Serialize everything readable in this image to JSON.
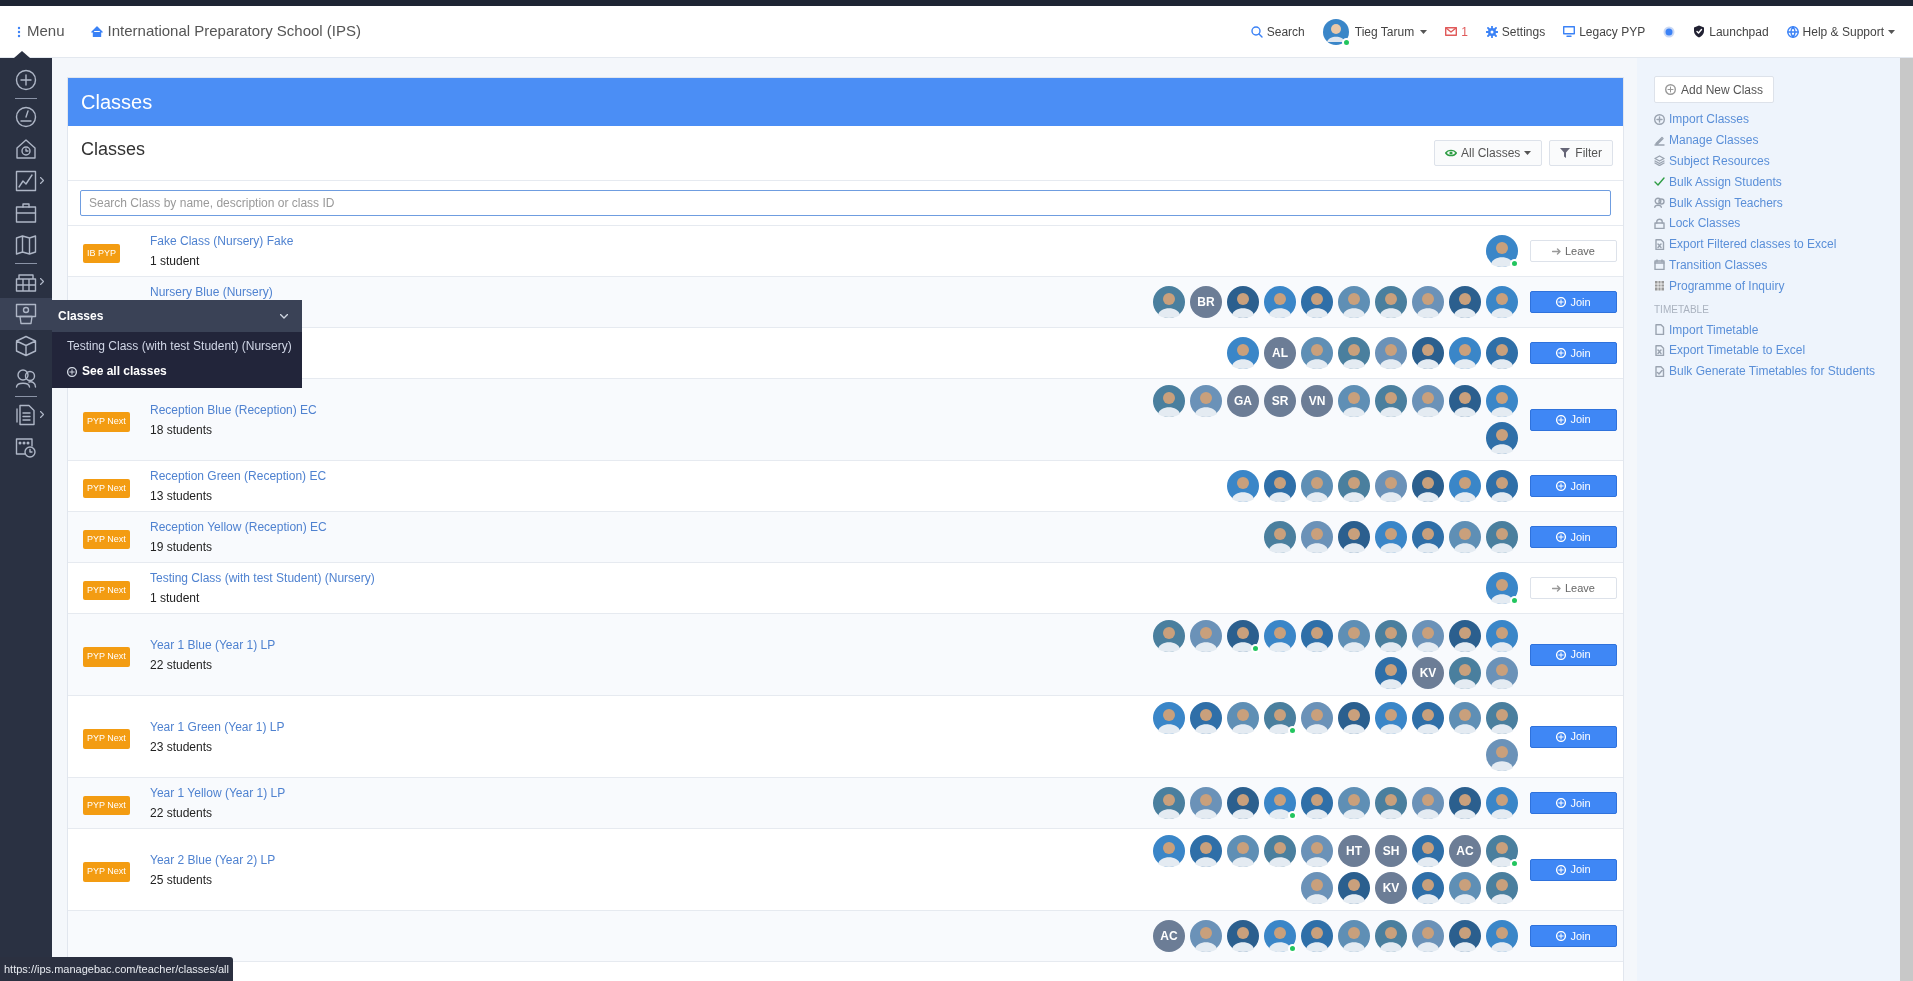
{
  "top_bar": {
    "menu_label": "Menu",
    "school": "International Preparatory School (IPS)",
    "search": "Search",
    "user": {
      "name": "Tieg Tarum",
      "online": true
    },
    "messages": "1",
    "settings": "Settings",
    "legacy": "Legacy PYP",
    "launchpad": "Launchpad",
    "help": "Help & Support"
  },
  "sidebar": {
    "items": [
      {
        "selected": false,
        "submenu": false
      },
      {
        "selected": false,
        "submenu": false
      },
      {
        "selected": false,
        "submenu": false
      },
      {
        "selected": false,
        "submenu": true
      },
      {
        "selected": false,
        "submenu": false
      },
      {
        "selected": false,
        "submenu": false
      },
      {
        "selected": false,
        "submenu": true
      },
      {
        "selected": true,
        "submenu": false
      },
      {
        "selected": false,
        "submenu": false
      },
      {
        "selected": false,
        "submenu": false
      },
      {
        "selected": false,
        "submenu": true
      },
      {
        "selected": false,
        "submenu": false
      }
    ]
  },
  "classes_flyout": {
    "title": "Classes",
    "items": [
      "Testing Class (with test Student) (Nursery)"
    ],
    "see_all": "See all classes"
  },
  "page": {
    "banner": "Classes",
    "subtitle": "Classes",
    "view_button": "All Classes",
    "filter_button": "Filter",
    "search": {
      "placeholder": "Search Class by name, description or class ID"
    }
  },
  "classes": [
    {
      "badge": "IB PYP",
      "name": "Fake Class (Nursery) Fake",
      "count": "1 student",
      "members": [
        {
          "kind": "photo",
          "online": true
        }
      ],
      "action": {
        "kind": "leave",
        "label": "Leave"
      }
    },
    {
      "name": "Nursery Blue (Nursery)",
      "members": [
        {
          "kind": "photo",
          "online": false
        },
        {
          "kind": "initials",
          "text": "BR",
          "online": false
        },
        {
          "kind": "photo",
          "online": false
        },
        {
          "kind": "photo",
          "online": false
        },
        {
          "kind": "photo",
          "online": false
        },
        {
          "kind": "photo",
          "online": false
        },
        {
          "kind": "photo",
          "online": false
        },
        {
          "kind": "photo",
          "online": false
        },
        {
          "kind": "photo",
          "online": false
        },
        {
          "kind": "photo",
          "online": false
        }
      ],
      "action": {
        "kind": "join",
        "label": "Join"
      }
    },
    {
      "members": [
        {
          "kind": "photo",
          "online": false
        },
        {
          "kind": "initials",
          "text": "AL",
          "online": false
        },
        {
          "kind": "photo",
          "online": false
        },
        {
          "kind": "photo",
          "online": false
        },
        {
          "kind": "photo",
          "online": false
        },
        {
          "kind": "photo",
          "online": false
        },
        {
          "kind": "photo",
          "online": false
        },
        {
          "kind": "photo",
          "online": false
        }
      ],
      "action": {
        "kind": "join",
        "label": "Join"
      }
    },
    {
      "badge": "PYP Next",
      "name": "Reception Blue (Reception) EC",
      "count": "18 students",
      "members": [
        {
          "kind": "photo",
          "online": false
        },
        {
          "kind": "photo",
          "online": false
        },
        {
          "kind": "initials",
          "text": "GA",
          "online": false
        },
        {
          "kind": "initials",
          "text": "SR",
          "online": false
        },
        {
          "kind": "initials",
          "text": "VN",
          "online": false
        },
        {
          "kind": "photo",
          "online": false
        },
        {
          "kind": "photo",
          "online": false
        },
        {
          "kind": "photo",
          "online": false
        },
        {
          "kind": "photo",
          "online": false
        },
        {
          "kind": "photo",
          "online": false
        },
        {
          "kind": "photo",
          "online": false
        }
      ],
      "action": {
        "kind": "join",
        "label": "Join"
      }
    },
    {
      "badge": "PYP Next",
      "name": "Reception Green (Reception) EC",
      "count": "13 students",
      "members": [
        {
          "kind": "photo",
          "online": false
        },
        {
          "kind": "photo",
          "online": false
        },
        {
          "kind": "photo",
          "online": false
        },
        {
          "kind": "photo",
          "online": false
        },
        {
          "kind": "photo",
          "online": false
        },
        {
          "kind": "photo",
          "online": false
        },
        {
          "kind": "photo",
          "online": false
        },
        {
          "kind": "photo",
          "online": false
        }
      ],
      "action": {
        "kind": "join",
        "label": "Join"
      }
    },
    {
      "badge": "PYP Next",
      "name": "Reception Yellow (Reception) EC",
      "count": "19 students",
      "members": [
        {
          "kind": "photo",
          "online": false
        },
        {
          "kind": "photo",
          "online": false
        },
        {
          "kind": "photo",
          "online": false
        },
        {
          "kind": "photo",
          "online": false
        },
        {
          "kind": "photo",
          "online": false
        },
        {
          "kind": "photo",
          "online": false
        },
        {
          "kind": "photo",
          "online": false
        }
      ],
      "action": {
        "kind": "join",
        "label": "Join"
      }
    },
    {
      "badge": "PYP Next",
      "name": "Testing Class (with test Student) (Nursery)",
      "count": "1 student",
      "members": [
        {
          "kind": "photo",
          "online": true
        }
      ],
      "action": {
        "kind": "leave",
        "label": "Leave"
      }
    },
    {
      "badge": "PYP Next",
      "name": "Year 1 Blue (Year 1) LP",
      "count": "22 students",
      "members": [
        {
          "kind": "photo",
          "online": false
        },
        {
          "kind": "photo",
          "online": false
        },
        {
          "kind": "photo",
          "online": true
        },
        {
          "kind": "photo",
          "online": false
        },
        {
          "kind": "photo",
          "online": false
        },
        {
          "kind": "photo",
          "online": false
        },
        {
          "kind": "photo",
          "online": false
        },
        {
          "kind": "photo",
          "online": false
        },
        {
          "kind": "photo",
          "online": false
        },
        {
          "kind": "photo",
          "online": false
        },
        {
          "kind": "photo",
          "online": false
        },
        {
          "kind": "initials",
          "text": "KV",
          "online": false
        },
        {
          "kind": "photo",
          "online": false
        },
        {
          "kind": "photo",
          "online": false
        }
      ],
      "action": {
        "kind": "join",
        "label": "Join"
      }
    },
    {
      "badge": "PYP Next",
      "name": "Year 1 Green (Year 1) LP",
      "count": "23 students",
      "members": [
        {
          "kind": "photo",
          "online": false
        },
        {
          "kind": "photo",
          "online": false
        },
        {
          "kind": "photo",
          "online": false
        },
        {
          "kind": "photo",
          "online": true
        },
        {
          "kind": "photo",
          "online": false
        },
        {
          "kind": "photo",
          "online": false
        },
        {
          "kind": "photo",
          "online": false
        },
        {
          "kind": "photo",
          "online": false
        },
        {
          "kind": "photo",
          "online": false
        },
        {
          "kind": "photo",
          "online": false
        },
        {
          "kind": "photo",
          "online": false
        }
      ],
      "action": {
        "kind": "join",
        "label": "Join"
      }
    },
    {
      "badge": "PYP Next",
      "name": "Year 1 Yellow (Year 1) LP",
      "count": "22 students",
      "members": [
        {
          "kind": "photo",
          "online": false
        },
        {
          "kind": "photo",
          "online": false
        },
        {
          "kind": "photo",
          "online": false
        },
        {
          "kind": "photo",
          "online": true
        },
        {
          "kind": "photo",
          "online": false
        },
        {
          "kind": "photo",
          "online": false
        },
        {
          "kind": "photo",
          "online": false
        },
        {
          "kind": "photo",
          "online": false
        },
        {
          "kind": "photo",
          "online": false
        },
        {
          "kind": "photo",
          "online": false
        }
      ],
      "action": {
        "kind": "join",
        "label": "Join"
      }
    },
    {
      "badge": "PYP Next",
      "name": "Year 2 Blue (Year 2) LP",
      "count": "25 students",
      "members": [
        {
          "kind": "photo",
          "online": false
        },
        {
          "kind": "photo",
          "online": false
        },
        {
          "kind": "photo",
          "online": false
        },
        {
          "kind": "photo",
          "online": false
        },
        {
          "kind": "photo",
          "online": false
        },
        {
          "kind": "initials",
          "text": "HT",
          "online": false
        },
        {
          "kind": "initials",
          "text": "SH",
          "online": false
        },
        {
          "kind": "photo",
          "online": false
        },
        {
          "kind": "initials",
          "text": "AC",
          "online": false
        },
        {
          "kind": "photo",
          "online": true
        },
        {
          "kind": "photo",
          "online": false
        },
        {
          "kind": "photo",
          "online": false
        },
        {
          "kind": "initials",
          "text": "KV",
          "online": false
        },
        {
          "kind": "photo",
          "online": false
        },
        {
          "kind": "photo",
          "online": false
        },
        {
          "kind": "photo",
          "online": false
        }
      ],
      "action": {
        "kind": "join",
        "label": "Join"
      }
    },
    {
      "members": [
        {
          "kind": "initials",
          "text": "AC",
          "online": false
        },
        {
          "kind": "photo",
          "online": false
        },
        {
          "kind": "photo",
          "online": false
        },
        {
          "kind": "photo",
          "online": true
        },
        {
          "kind": "photo",
          "online": false
        },
        {
          "kind": "photo",
          "online": false
        },
        {
          "kind": "photo",
          "online": false
        },
        {
          "kind": "photo",
          "online": false
        },
        {
          "kind": "photo",
          "online": false
        },
        {
          "kind": "photo",
          "online": false
        }
      ],
      "action": {
        "kind": "join",
        "label": "Join"
      }
    }
  ],
  "actions_panel": {
    "add_button": "Add New Class",
    "links": [
      "Import Classes",
      "Manage Classes",
      "Subject Resources",
      "Bulk Assign Students",
      "Bulk Assign Teachers",
      "Lock Classes",
      "Export Filtered classes to Excel",
      "Transition Classes",
      "Programme of Inquiry"
    ],
    "timetable_header": "TIMETABLE",
    "timetable_links": [
      "Import Timetable",
      "Export Timetable to Excel",
      "Bulk Generate Timetables for Students"
    ]
  },
  "status_url": "https://ips.managebac.com/teacher/classes/all"
}
